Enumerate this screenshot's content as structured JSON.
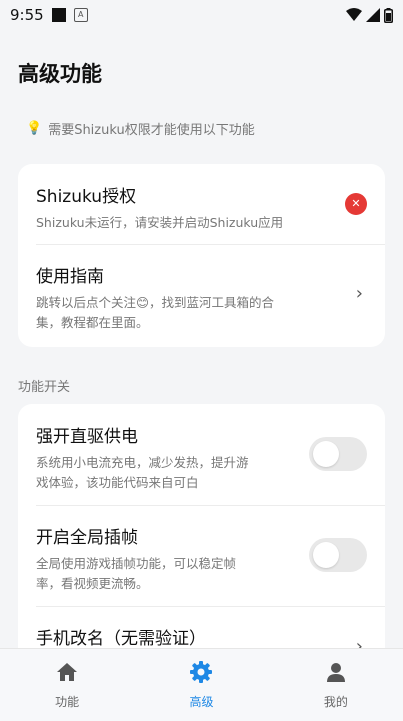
{
  "status_bar": {
    "time": "9:55",
    "colors": {
      "icon": "#111111"
    }
  },
  "page": {
    "title": "高级功能"
  },
  "hint": {
    "icon": "lightbulb-icon",
    "text": "需要Shizuku权限才能使用以下功能"
  },
  "auth_card": {
    "shizuku": {
      "title": "Shizuku授权",
      "subtitle": "Shizuku未运行，请安装并启动Shizuku应用",
      "status_icon": "error-x-icon",
      "status_color": "#e53935"
    },
    "guide": {
      "title": "使用指南",
      "subtitle_line1": "跳转以后点个关注😊，找到蓝河工具箱的合",
      "subtitle_line2": "集，教程都在里面。"
    }
  },
  "section": {
    "label": "功能开关"
  },
  "features": [
    {
      "title": "强开直驱供电",
      "line1": "系统用小电流充电，减少发热，提升游",
      "line2": "戏体验，该功能代码来自可白",
      "enabled": false
    },
    {
      "title": "开启全局插帧",
      "line1": "全局使用游戏插帧功能，可以稳定帧",
      "line2": "率，看视频更流畅。",
      "enabled": false
    },
    {
      "title": "手机改名（无需验证）"
    }
  ],
  "bottom_nav": {
    "items": [
      {
        "label": "功能",
        "icon": "home-icon",
        "active": false
      },
      {
        "label": "高级",
        "icon": "gear-icon",
        "active": true
      },
      {
        "label": "我的",
        "icon": "person-icon",
        "active": false
      }
    ],
    "accent": "#1e88e5"
  }
}
